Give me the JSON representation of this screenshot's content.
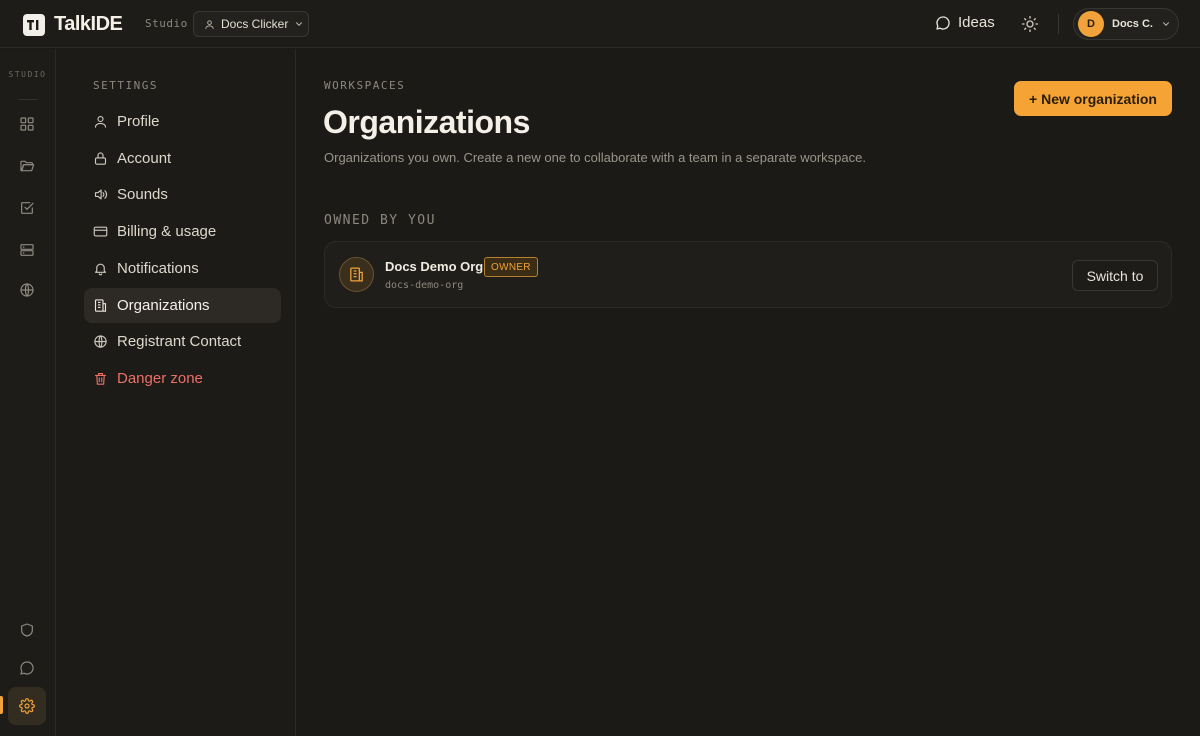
{
  "app": {
    "logo_mark": "TI",
    "name": "TalkIDE",
    "section_label": "Studio"
  },
  "header": {
    "workspace_label": "Docs Clicker",
    "ideas_label": "Ideas",
    "user_initial": "D",
    "user_name": "Docs C."
  },
  "rail": {
    "label": "STUDIO",
    "icons": [
      "grid-icon",
      "folder-icon",
      "checkbox-icon",
      "server-icon",
      "globe-icon",
      "shield-icon",
      "chat-icon",
      "gear-icon"
    ]
  },
  "settings_nav": {
    "heading": "SETTINGS",
    "items": [
      {
        "label": "Profile",
        "icon": "user-icon"
      },
      {
        "label": "Account",
        "icon": "lock-icon"
      },
      {
        "label": "Sounds",
        "icon": "speaker-icon"
      },
      {
        "label": "Billing & usage",
        "icon": "credit-card-icon"
      },
      {
        "label": "Notifications",
        "icon": "bell-icon"
      },
      {
        "label": "Organizations",
        "icon": "building-icon"
      },
      {
        "label": "Registrant Contact",
        "icon": "globe-icon"
      },
      {
        "label": "Danger zone",
        "icon": "trash-icon"
      }
    ],
    "active_item": "Organizations"
  },
  "main": {
    "eyebrow": "WORKSPACES",
    "title": "Organizations",
    "description": "Organizations you own. Create a new one to collaborate with a team in a separate workspace.",
    "new_button_label": "+ New organization",
    "section_label": "OWNED BY YOU",
    "organizations": [
      {
        "name": "Docs Demo Org",
        "badge": "OWNER",
        "slug": "docs-demo-org",
        "action_label": "Switch to"
      }
    ]
  },
  "colors": {
    "accent": "#f5a334",
    "background": "#1b1a17",
    "danger": "#ec6f66"
  }
}
